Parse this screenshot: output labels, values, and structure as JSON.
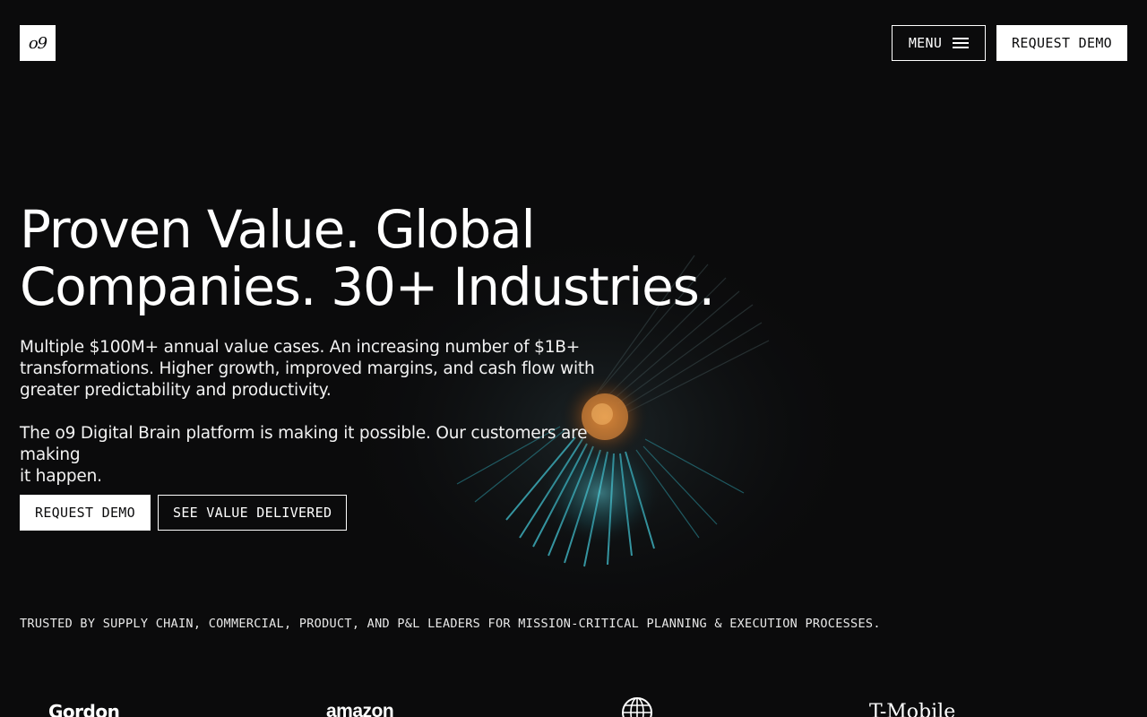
{
  "header": {
    "logo_text": "o9",
    "menu_label": "MENU",
    "request_demo_label": "REQUEST DEMO"
  },
  "hero": {
    "headline_line1": "Proven Value. Global",
    "headline_line2": "Companies. 30+ Industries.",
    "para1_line1": "Multiple $100M+ annual value cases. An increasing number of $1B+",
    "para1_line2": "transformations. Higher growth, improved margins, and cash flow with",
    "para1_line3": "greater predictability and productivity.",
    "para2_line1": "The o9 Digital Brain platform is making it possible. Our customers are making",
    "para2_line2": "it happen.",
    "cta_primary": "REQUEST DEMO",
    "cta_secondary": "SEE VALUE DELIVERED"
  },
  "trusted": {
    "text": "TRUSTED BY SUPPLY CHAIN, COMMERCIAL, PRODUCT, AND P&L LEADERS FOR MISSION-CRITICAL PLANNING & EXECUTION PROCESSES."
  },
  "logos": [
    {
      "name": "Gordon",
      "icon": "gordon-logo"
    },
    {
      "name": "amazon",
      "icon": "amazon-logo"
    },
    {
      "name": "",
      "icon": "globe-logo"
    },
    {
      "name": "T-Mobile",
      "icon": "tmobile-logo"
    }
  ],
  "colors": {
    "background": "#0b0b0c",
    "foreground": "#ffffff",
    "accent_teal": "#3fb6c4",
    "accent_orange": "#c9772a"
  }
}
